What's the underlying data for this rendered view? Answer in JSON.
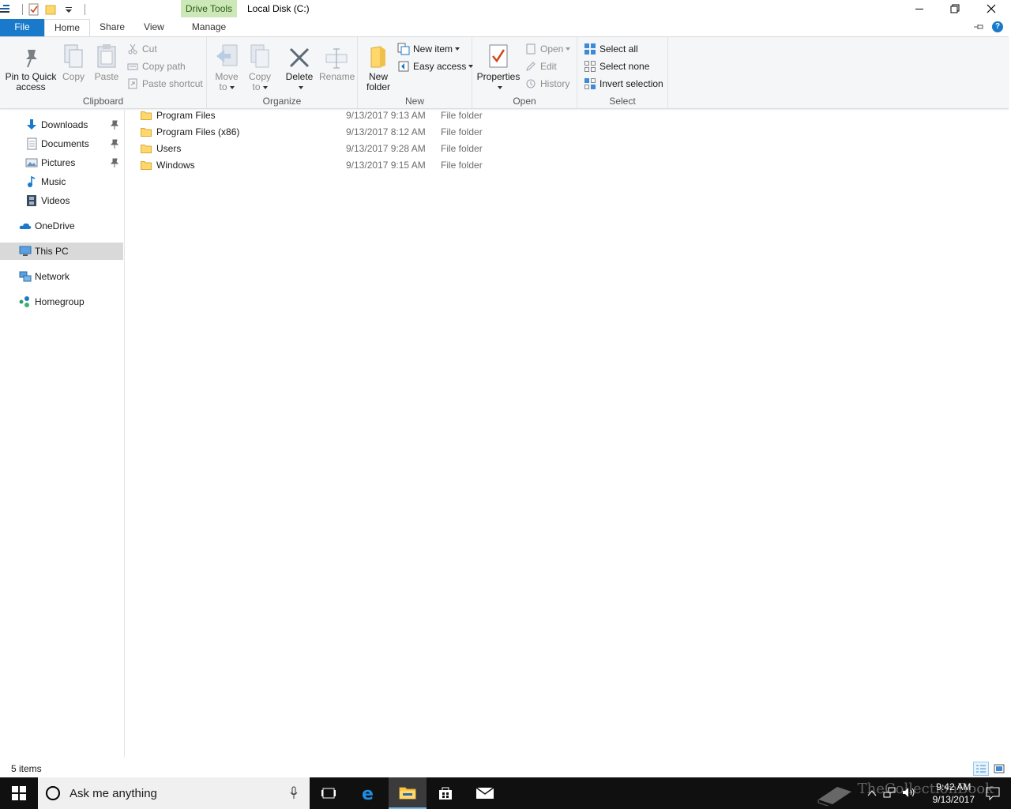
{
  "window": {
    "title": "Local Disk (C:)",
    "contextual_tab_group": "Drive Tools"
  },
  "tabs": {
    "file": "File",
    "home": "Home",
    "share": "Share",
    "view": "View",
    "manage": "Manage"
  },
  "ribbon": {
    "clipboard": {
      "label": "Clipboard",
      "pin": "Pin to Quick access",
      "pin_line1": "Pin to Quick",
      "pin_line2": "access",
      "copy": "Copy",
      "paste": "Paste",
      "cut": "Cut",
      "copy_path": "Copy path",
      "paste_shortcut": "Paste shortcut"
    },
    "organize": {
      "label": "Organize",
      "move_to_line1": "Move",
      "move_to_line2": "to",
      "copy_to_line1": "Copy",
      "copy_to_line2": "to",
      "delete": "Delete",
      "rename": "Rename"
    },
    "new": {
      "label": "New",
      "new_folder_line1": "New",
      "new_folder_line2": "folder",
      "new_item": "New item",
      "easy_access": "Easy access"
    },
    "open": {
      "label": "Open",
      "properties": "Properties",
      "open": "Open",
      "edit": "Edit",
      "history": "History"
    },
    "select": {
      "label": "Select",
      "select_all": "Select all",
      "select_none": "Select none",
      "invert_selection": "Invert selection"
    }
  },
  "nav": {
    "items": [
      {
        "label": "Downloads",
        "pinned": true
      },
      {
        "label": "Documents",
        "pinned": true
      },
      {
        "label": "Pictures",
        "pinned": true
      },
      {
        "label": "Music",
        "pinned": false
      },
      {
        "label": "Videos",
        "pinned": false
      },
      {
        "label": "OneDrive",
        "pinned": false
      },
      {
        "label": "This PC",
        "pinned": false,
        "selected": true
      },
      {
        "label": "Network",
        "pinned": false
      },
      {
        "label": "Homegroup",
        "pinned": false
      }
    ]
  },
  "files": [
    {
      "name": "Program Files",
      "date": "9/13/2017 9:13 AM",
      "type": "File folder"
    },
    {
      "name": "Program Files (x86)",
      "date": "9/13/2017 8:12 AM",
      "type": "File folder"
    },
    {
      "name": "Users",
      "date": "9/13/2017 9:28 AM",
      "type": "File folder"
    },
    {
      "name": "Windows",
      "date": "9/13/2017 9:15 AM",
      "type": "File folder"
    }
  ],
  "status": {
    "item_count": "5 items"
  },
  "taskbar": {
    "search_placeholder": "Ask me anything",
    "time": "9:42 AM",
    "date": "9/13/2017",
    "watermark": "TheCollectionBook"
  },
  "colors": {
    "accent": "#1979ca",
    "drive_tools": "#cde8b8",
    "taskbar": "#101010",
    "folder": "#ffd76b"
  }
}
